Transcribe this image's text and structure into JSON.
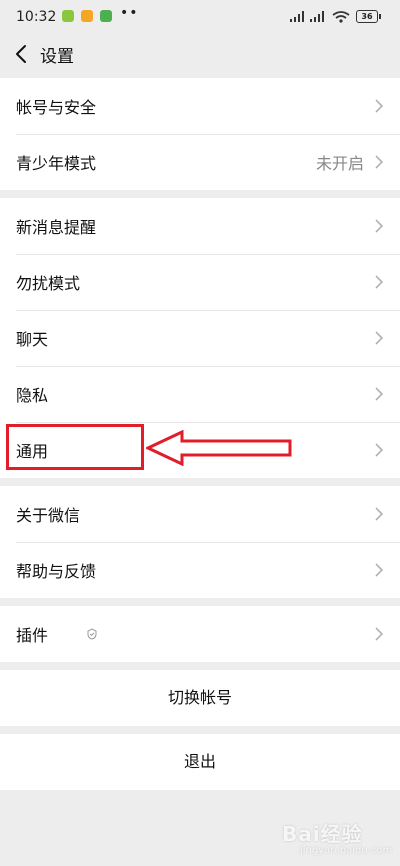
{
  "status_bar": {
    "time": "10:32",
    "battery": "36",
    "dots": "••"
  },
  "header": {
    "title": "设置"
  },
  "sections": [
    [
      {
        "label": "帐号与安全",
        "value": ""
      },
      {
        "label": "青少年模式",
        "value": "未开启"
      }
    ],
    [
      {
        "label": "新消息提醒",
        "value": ""
      },
      {
        "label": "勿扰模式",
        "value": ""
      },
      {
        "label": "聊天",
        "value": ""
      },
      {
        "label": "隐私",
        "value": ""
      },
      {
        "label": "通用",
        "value": ""
      }
    ],
    [
      {
        "label": "关于微信",
        "value": ""
      },
      {
        "label": "帮助与反馈",
        "value": ""
      }
    ],
    [
      {
        "label": "插件",
        "value": ""
      }
    ]
  ],
  "actions": {
    "switch_account": "切换帐号",
    "logout": "退出"
  },
  "annotation": {
    "highlight_color": "#e11d2a",
    "target": "通用"
  },
  "watermark": {
    "text": "Bai经验",
    "url": "jingyan.baidu.com"
  },
  "colors": {
    "background": "#ededed",
    "row": "#ffffff",
    "muted_text": "#888888"
  }
}
